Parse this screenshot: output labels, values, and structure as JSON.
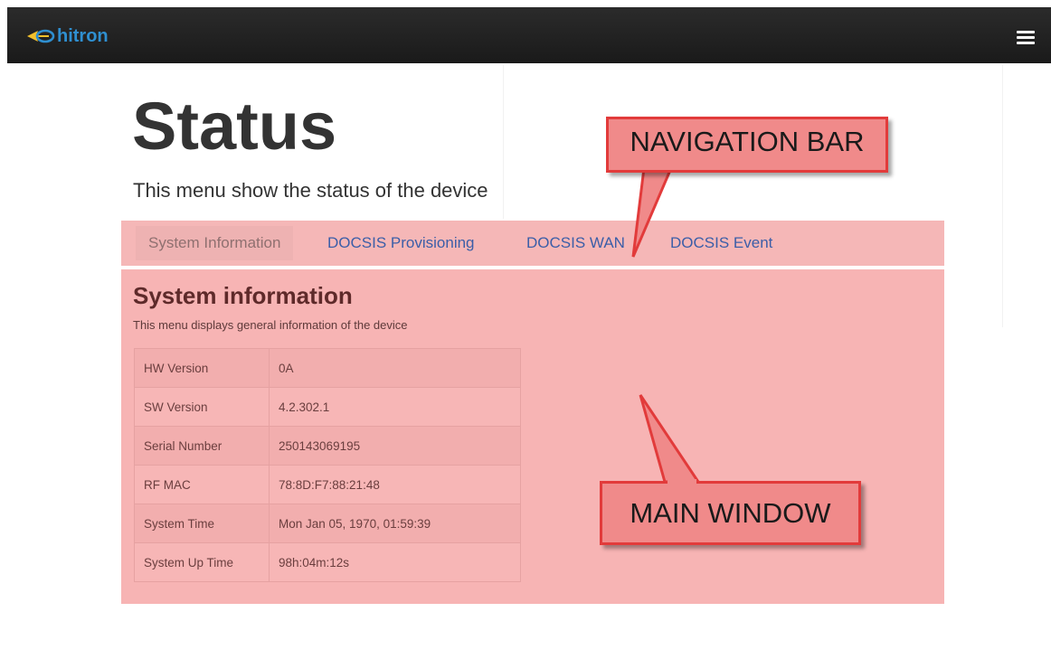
{
  "header": {
    "logo_text": "hitron",
    "brand_color": "#2f8fd0",
    "menu_icon": "hamburger-menu-icon"
  },
  "page": {
    "title": "Status",
    "subtitle": "This menu show the status of the device"
  },
  "tabs": [
    {
      "label": "System Information",
      "active": true
    },
    {
      "label": "DOCSIS Provisioning",
      "active": false
    },
    {
      "label": "DOCSIS WAN",
      "active": false
    },
    {
      "label": "DOCSIS Event",
      "active": false
    }
  ],
  "section": {
    "title": "System information",
    "description": "This menu displays general information of the device"
  },
  "info_table": [
    {
      "key": "HW Version",
      "value": "0A"
    },
    {
      "key": "SW Version",
      "value": "4.2.302.1"
    },
    {
      "key": "Serial Number",
      "value": "250143069195"
    },
    {
      "key": "RF MAC",
      "value": "78:8D:F7:88:21:48"
    },
    {
      "key": "System Time",
      "value": "Mon Jan 05, 1970, 01:59:39"
    },
    {
      "key": "System Up Time",
      "value": "98h:04m:12s"
    }
  ],
  "callouts": {
    "navigation_bar": "NAVIGATION BAR",
    "main_window": "MAIN WINDOW"
  },
  "colors": {
    "callout_fill": "#f08a8a",
    "callout_border": "#e23b3b",
    "highlight": "#f7b4b4",
    "link": "#3b5ea8"
  }
}
